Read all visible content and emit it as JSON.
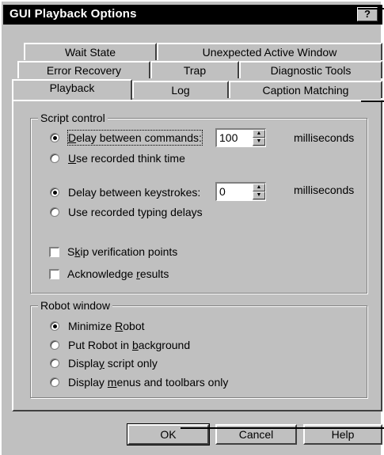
{
  "window": {
    "title": "GUI Playback Options",
    "help_glyph": "?"
  },
  "tabs": {
    "row1": [
      "Wait State",
      "Unexpected Active Window"
    ],
    "row2": [
      "Error Recovery",
      "Trap",
      "Diagnostic Tools"
    ],
    "row3": [
      "Playback",
      "Log",
      "Caption Matching"
    ],
    "active": "Playback"
  },
  "script_control": {
    "group_label": "Script control",
    "delay_commands": {
      "pre": "",
      "u": "D",
      "post": "elay between commands:",
      "selected": true
    },
    "commands_value": "100",
    "recorded_think": {
      "pre": "",
      "u": "U",
      "post": "se recorded think time",
      "selected": false
    },
    "delay_keystrokes": {
      "label": "Delay between keystrokes:",
      "selected": true
    },
    "keystrokes_value": "0",
    "recorded_typing": {
      "label": "Use recorded typing delays",
      "selected": false
    },
    "unit": "milliseconds",
    "skip_verification": {
      "pre": "S",
      "u": "k",
      "post": "ip verification points",
      "checked": false
    },
    "acknowledge_results": {
      "pre": "Acknowledge ",
      "u": "r",
      "post": "esults",
      "checked": false
    }
  },
  "robot_window": {
    "group_label": "Robot window",
    "minimize": {
      "pre": "Minimize ",
      "u": "R",
      "post": "obot",
      "selected": true
    },
    "background": {
      "pre": "Put Robot in ",
      "u": "b",
      "post": "ackground",
      "selected": false
    },
    "script_only": {
      "pre": "Displa",
      "u": "y",
      "post": " script only",
      "selected": false
    },
    "menus_toolbars": {
      "pre": "Display ",
      "u": "m",
      "post": "enus and toolbars only",
      "selected": false
    }
  },
  "buttons": {
    "ok": "OK",
    "cancel": "Cancel",
    "help": "Help"
  }
}
